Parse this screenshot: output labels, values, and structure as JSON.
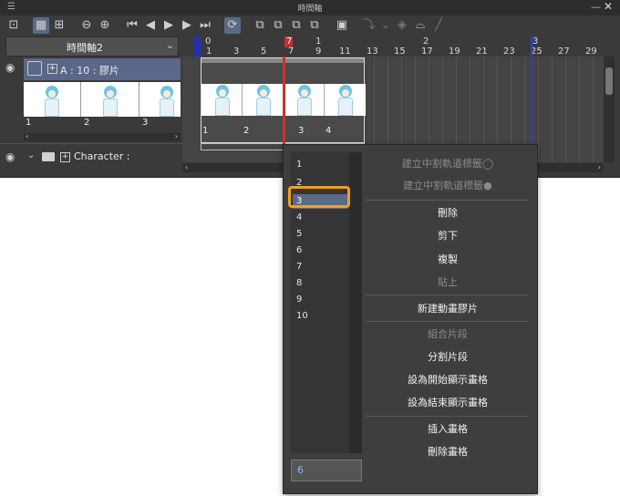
{
  "window": {
    "title": "時間軸"
  },
  "timeline": {
    "name": "時間軸2",
    "ruler_top": [
      "0",
      "7",
      "1",
      "2",
      "3"
    ],
    "ruler_bottom": [
      "1",
      "3",
      "5",
      "7",
      "9",
      "11",
      "13",
      "15",
      "17",
      "19",
      "21",
      "23",
      "25",
      "27",
      "29"
    ]
  },
  "layers": {
    "animation_layer": {
      "label": "A : 10 : 膠片"
    },
    "thumb_numbers": [
      "1",
      "2",
      "3"
    ],
    "character_folder": {
      "label": "Character :"
    }
  },
  "clip": {
    "frame_numbers": [
      "1",
      "2",
      "3",
      "4"
    ]
  },
  "popup": {
    "frame_list": [
      "1",
      "2",
      "3",
      "4",
      "5",
      "6",
      "7",
      "8",
      "9",
      "10"
    ],
    "selected_frame": "3",
    "input_value": "6",
    "menu": [
      {
        "label": "建立中割軌道標籤◯",
        "enabled": false
      },
      {
        "label": "建立中割軌道標籤●",
        "enabled": false
      },
      {
        "label": "刪除",
        "enabled": true
      },
      {
        "label": "剪下",
        "enabled": true
      },
      {
        "label": "複製",
        "enabled": true
      },
      {
        "label": "貼上",
        "enabled": false
      },
      {
        "label": "新建動畫膠片",
        "enabled": true
      },
      {
        "label": "組合片段",
        "enabled": false
      },
      {
        "label": "分割片段",
        "enabled": true
      },
      {
        "label": "設為開始顯示畫格",
        "enabled": true
      },
      {
        "label": "設為結束顯示畫格",
        "enabled": true
      },
      {
        "label": "插入畫格",
        "enabled": true
      },
      {
        "label": "刪除畫格",
        "enabled": true
      }
    ]
  },
  "colors": {
    "accent_highlight": "#f0a020",
    "playhead": "#c83232",
    "selection": "#5c6a86"
  }
}
